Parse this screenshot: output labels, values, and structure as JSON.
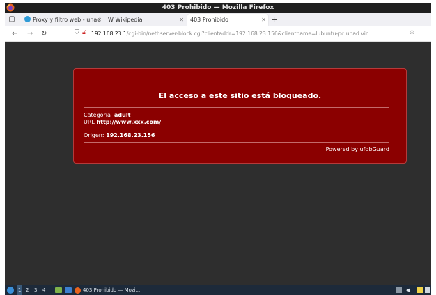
{
  "window": {
    "title": "403 Prohibido — Mozilla Firefox"
  },
  "tabs": [
    {
      "label": "Proxy y filtro web - unad",
      "active": false
    },
    {
      "label": "W Wikipedia",
      "active": false
    },
    {
      "label": "403 Prohibido",
      "active": true
    }
  ],
  "nav": {
    "url_host": "192.168.23.1",
    "url_path": "/cgi-bin/nethserver-block.cgi?clientaddr=192.168.23.156&clientname=lubuntu-pc.unad.vir..."
  },
  "block_page": {
    "heading": "El acceso a este sitio está bloqueado.",
    "category_label": "Categoria",
    "category_value": "adult",
    "url_label": "URL",
    "url_value": "http://www.xxx.com/",
    "origin_label": "Origen:",
    "origin_value": "192.168.23.156",
    "powered_prefix": "Powered by",
    "powered_link": "ufdbGuard"
  },
  "taskbar": {
    "workspaces": [
      "1",
      "2",
      "3",
      "4"
    ],
    "task_label": "403 Prohibido — Mozi..."
  },
  "colors": {
    "block_bg": "#8b0000",
    "page_bg": "#2e2e2e"
  }
}
